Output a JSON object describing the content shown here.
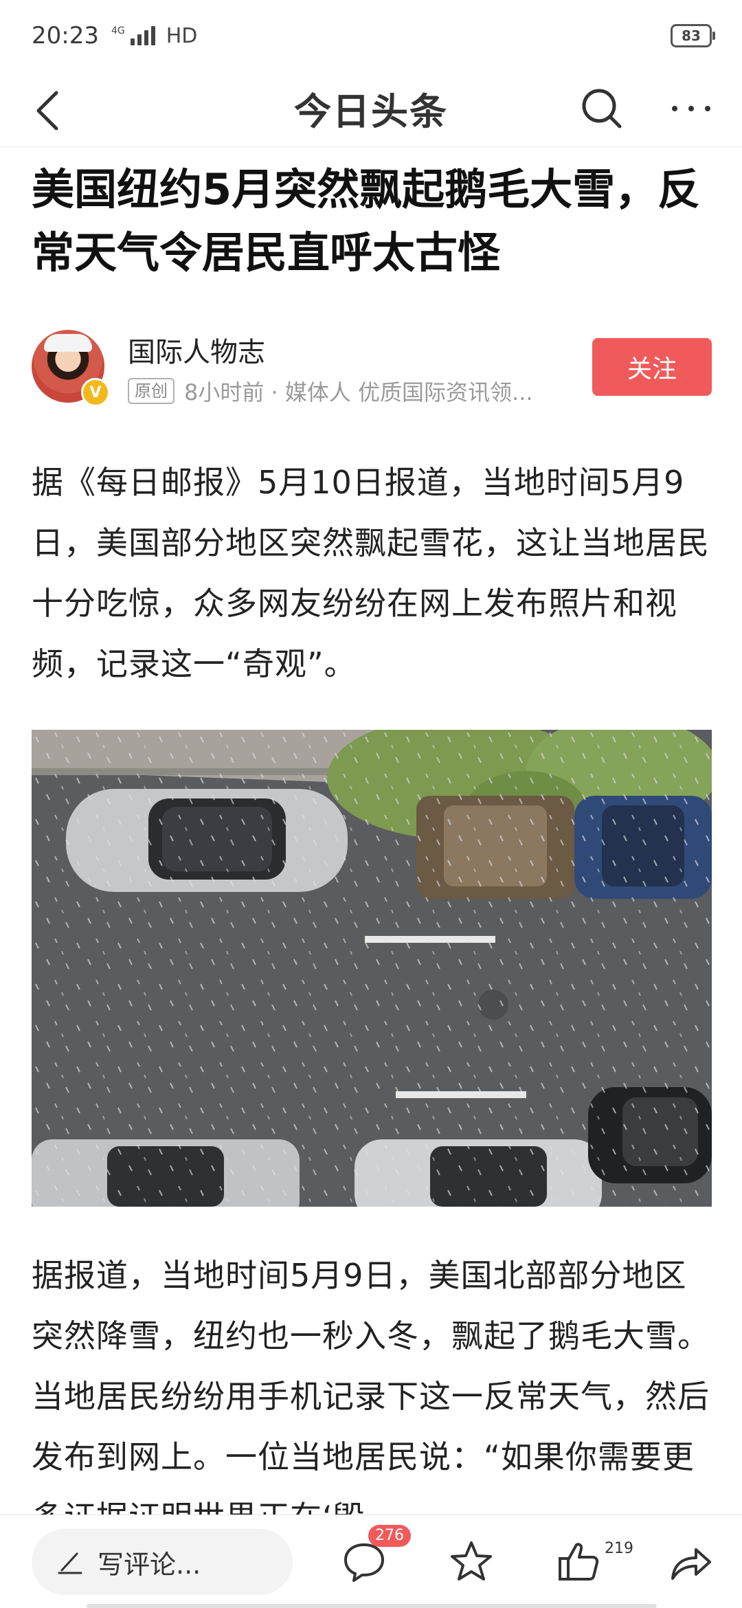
{
  "status_bar": {
    "time": "20:23",
    "network": "4G",
    "hd": "HD",
    "battery": "83"
  },
  "header": {
    "title": "今日头条"
  },
  "article": {
    "title": "美国纽约5月突然飘起鹅毛大雪，反常天气令居民直呼太古怪",
    "author": {
      "name": "国际人物志",
      "badge": "V",
      "original_tag": "原创",
      "meta": "8小时前 · 媒体人 优质国际资讯领..."
    },
    "follow_label": "关注",
    "paragraph1": "据《每日邮报》5月10日报道，当地时间5月9日，美国部分地区突然飘起雪花，这让当地居民十分吃惊，众多网友纷纷在网上发布照片和视频，记录这一“奇观”。",
    "paragraph2": "据报道，当地时间5月9日，美国北部部分地区突然降雪，纽约也一秒入冬，飘起了鹅毛大雪。当地居民纷纷用手机记录下这一反常天气，然后发布到网上。一位当地居民说：“如果你需要更多证据证明世界正在‘毁"
  },
  "bottom_bar": {
    "comment_placeholder": "写评论...",
    "comment_count": "276",
    "like_count": "219"
  },
  "colors": {
    "accent": "#f15a5a",
    "badge_gold": "#f3b91c"
  },
  "icons": [
    "back-icon",
    "search-icon",
    "more-icon",
    "pen-icon",
    "comment-icon",
    "star-icon",
    "thumbs-up-icon",
    "share-icon"
  ]
}
